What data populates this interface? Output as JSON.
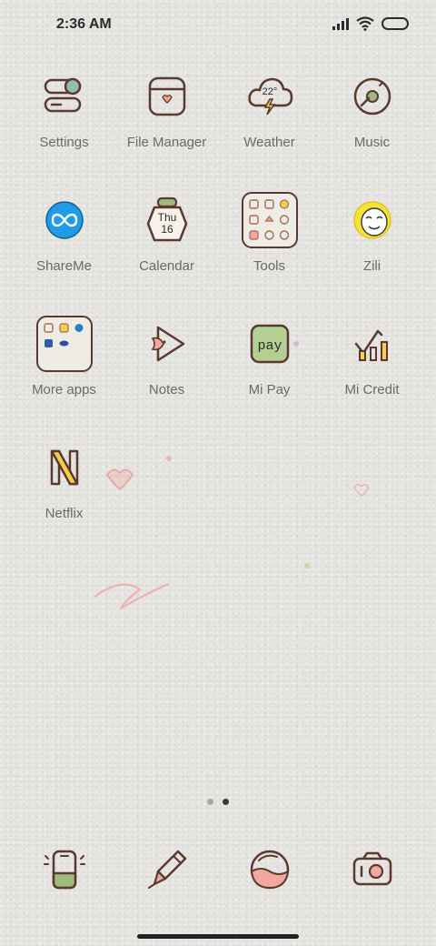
{
  "status_bar": {
    "time": "2:36 AM",
    "icons": [
      "signal-icon",
      "wifi-icon",
      "battery-icon"
    ]
  },
  "apps": [
    {
      "label": "Settings",
      "icon": "settings-toggle-icon"
    },
    {
      "label": "File Manager",
      "icon": "file-manager-icon"
    },
    {
      "label": "Weather",
      "icon": "weather-cloud-icon",
      "temp": "22°"
    },
    {
      "label": "Music",
      "icon": "music-disc-icon"
    },
    {
      "label": "ShareMe",
      "icon": "shareme-icon"
    },
    {
      "label": "Calendar",
      "icon": "calendar-icon",
      "day": "Thu",
      "date": "16"
    },
    {
      "label": "Tools",
      "icon": "tools-folder-icon"
    },
    {
      "label": "Zili",
      "icon": "zili-face-icon"
    },
    {
      "label": "More apps",
      "icon": "more-apps-folder-icon"
    },
    {
      "label": "Notes",
      "icon": "notes-play-icon"
    },
    {
      "label": "Mi Pay",
      "icon": "mi-pay-icon",
      "text": "pay"
    },
    {
      "label": "Mi Credit",
      "icon": "mi-credit-icon"
    },
    {
      "label": "Netflix",
      "icon": "netflix-icon"
    }
  ],
  "pages": {
    "count": 2,
    "active": 2
  },
  "dock": [
    {
      "icon": "phone-icon"
    },
    {
      "icon": "pen-messages-icon"
    },
    {
      "icon": "browser-globe-icon"
    },
    {
      "icon": "camera-icon"
    }
  ],
  "colors": {
    "background": "#e6e5e2",
    "outline": "#5a3a2e",
    "accent_green": "#9dbb7f",
    "accent_pink": "#f2a7a0",
    "accent_teal": "#8fbfae"
  }
}
